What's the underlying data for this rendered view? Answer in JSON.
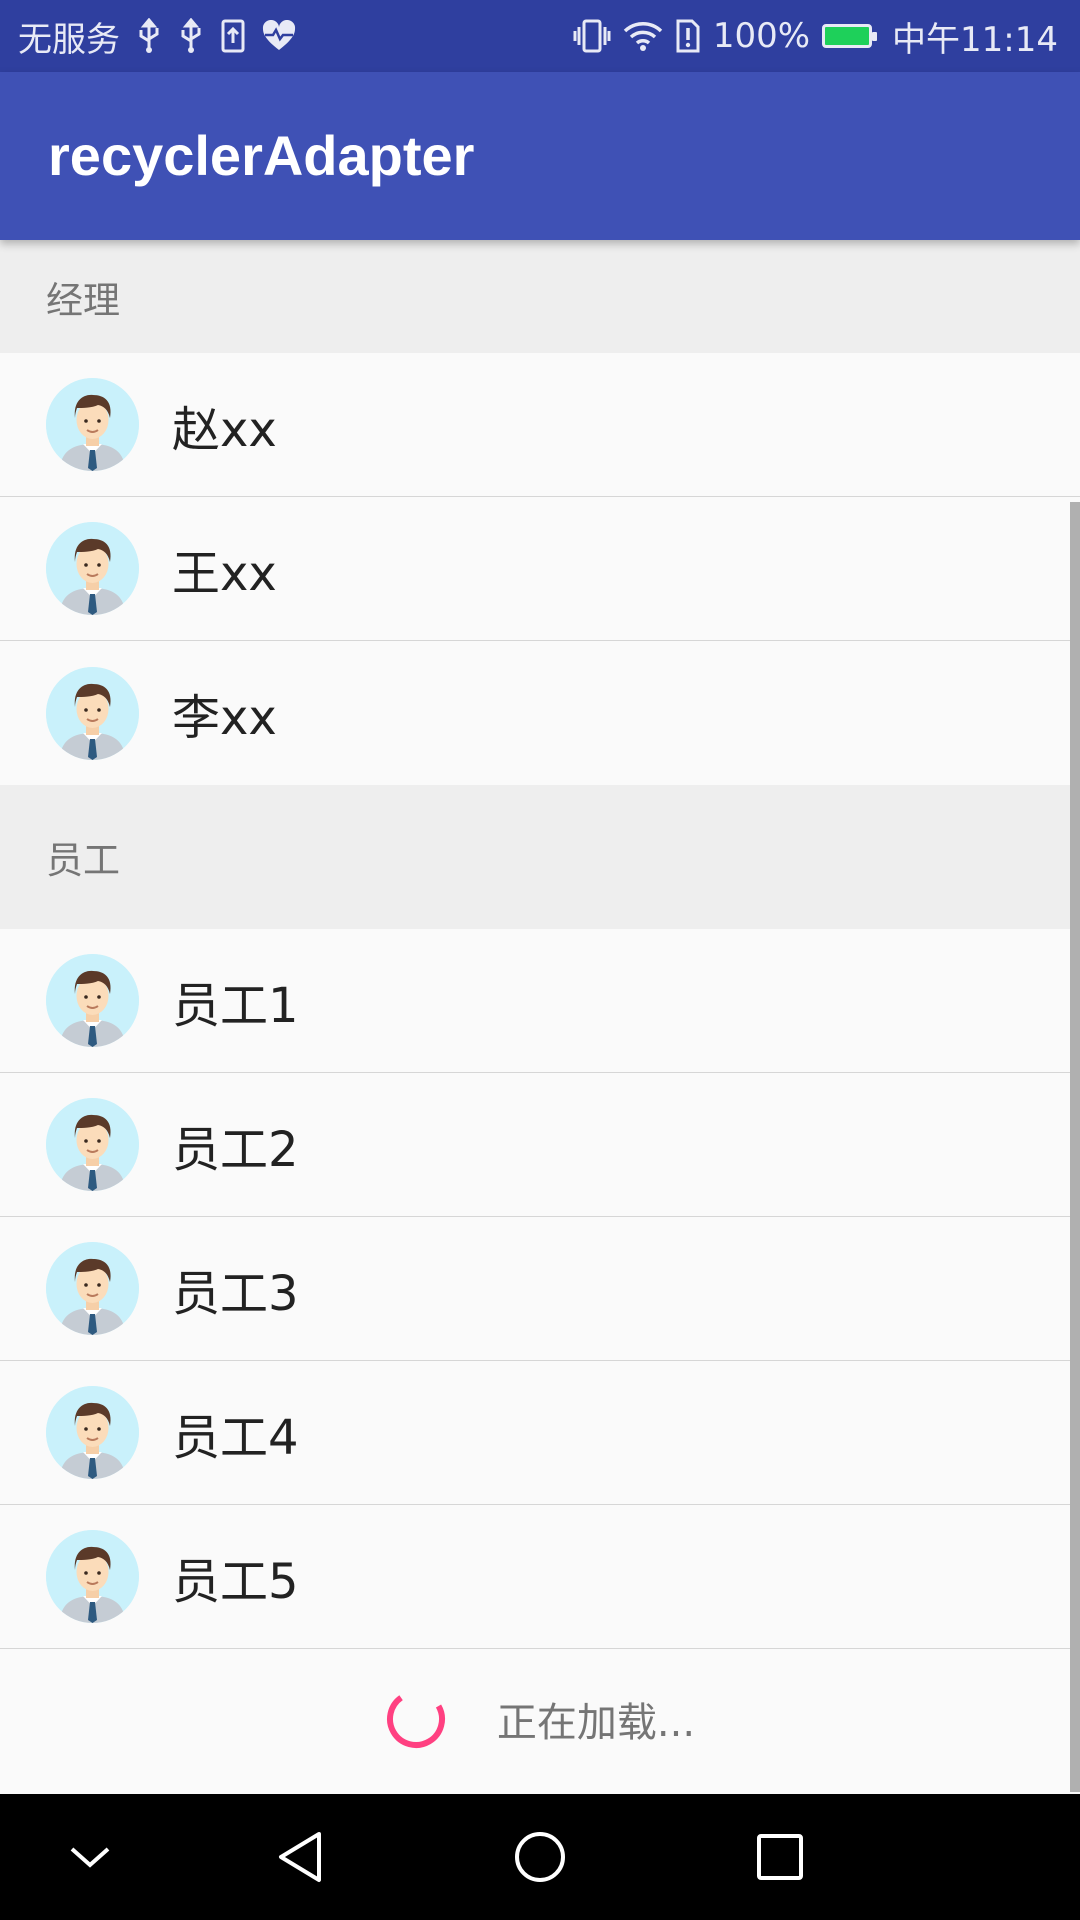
{
  "status_bar": {
    "carrier": "无服务",
    "battery_percent": "100%",
    "time": "中午11:14",
    "battery_level": 1.0,
    "icons_left": [
      "usb-icon",
      "usb-icon",
      "upload-icon",
      "heart-pulse-icon"
    ],
    "icons_right": [
      "vibrate-icon",
      "wifi-icon",
      "alert-icon",
      "battery-icon"
    ]
  },
  "app_bar": {
    "title": "recyclerAdapter"
  },
  "list": {
    "sections": [
      {
        "header": "经理",
        "items": [
          "赵xx",
          "王xx",
          "李xx"
        ]
      },
      {
        "header": "员工",
        "items": [
          "员工1",
          "员工2",
          "员工3",
          "员工4",
          "员工5"
        ]
      }
    ],
    "loading_text": "正在加载..."
  },
  "colors": {
    "status_bar": "#2f3f9f",
    "app_bar": "#3f51b5",
    "spinner": "#ff4081",
    "avatar_bg": "#c9f1fb"
  },
  "nav_bar": {
    "icons": [
      "chevron-down-icon",
      "back-icon",
      "home-icon",
      "recents-icon"
    ]
  }
}
